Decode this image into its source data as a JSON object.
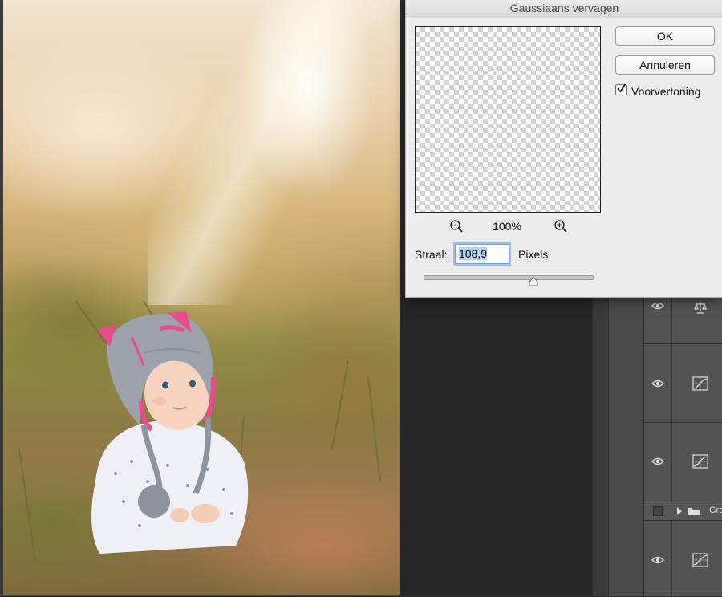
{
  "dialog": {
    "title": "Gaussiaans vervagen",
    "ok_label": "OK",
    "cancel_label": "Annuleren",
    "preview_label": "Voorvertoning",
    "preview_checked": true,
    "zoom_level": "100%",
    "radius_label": "Straal:",
    "radius_value": "108,9",
    "units_label": "Pixels"
  },
  "layers": {
    "group_label": "Gro",
    "rows": [
      {
        "visible": true,
        "icon": "balance-adjustment-icon"
      },
      {
        "visible": true,
        "icon": "curves-adjustment-icon"
      },
      {
        "visible": true,
        "icon": "curves-adjustment-icon"
      },
      {
        "visible": false,
        "icon": "folder-icon"
      },
      {
        "visible": true,
        "icon": "curves-adjustment-icon"
      }
    ]
  },
  "colors": {
    "dialog_bg": "#ececec",
    "panel_bg": "#535353",
    "input_focus": "#9ec0ee",
    "hat_pink": "#e84c8a"
  }
}
